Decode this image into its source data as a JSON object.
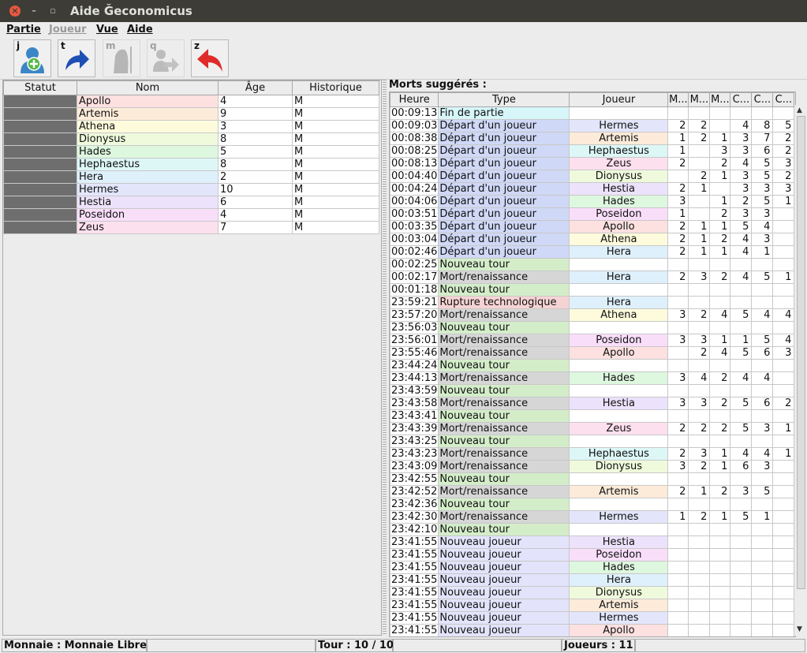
{
  "window": {
    "title": "Aide Ğeconomicus"
  },
  "menu": [
    "Partie",
    "Joueur",
    "Vue",
    "Aide"
  ],
  "toolbar": [
    {
      "key": "j",
      "icon": "add-player-icon",
      "enabled": true
    },
    {
      "key": "t",
      "icon": "next-turn-arrow-icon",
      "enabled": true
    },
    {
      "key": "m",
      "icon": "death-icon",
      "enabled": false
    },
    {
      "key": "q",
      "icon": "quit-player-icon",
      "enabled": false
    },
    {
      "key": "z",
      "icon": "undo-arrow-icon",
      "enabled": true
    }
  ],
  "players": {
    "columns": [
      "Statut",
      "Nom",
      "Âge",
      "Historique"
    ],
    "rows": [
      {
        "name": "Apollo",
        "age": "4",
        "history": "M",
        "color": "#fde0e0"
      },
      {
        "name": "Artemis",
        "age": "9",
        "history": "M",
        "color": "#fdebd9"
      },
      {
        "name": "Athena",
        "age": "3",
        "history": "M",
        "color": "#fdfbdc"
      },
      {
        "name": "Dionysus",
        "age": "8",
        "history": "M",
        "color": "#effadc"
      },
      {
        "name": "Hades",
        "age": "5",
        "history": "M",
        "color": "#def7df"
      },
      {
        "name": "Hephaestus",
        "age": "8",
        "history": "M",
        "color": "#dcf7f6"
      },
      {
        "name": "Hera",
        "age": "2",
        "history": "M",
        "color": "#def0fb"
      },
      {
        "name": "Hermes",
        "age": "10",
        "history": "M",
        "color": "#e3e6fb"
      },
      {
        "name": "Hestia",
        "age": "6",
        "history": "M",
        "color": "#ece2fb"
      },
      {
        "name": "Poseidon",
        "age": "4",
        "history": "M",
        "color": "#f9defa"
      },
      {
        "name": "Zeus",
        "age": "7",
        "history": "M",
        "color": "#fde0ee"
      }
    ]
  },
  "events": {
    "title": "Morts suggérés :",
    "columns": [
      "Heure",
      "Type",
      "Joueur",
      "M...",
      "M...",
      "M...",
      "C...",
      "C...",
      "C..."
    ],
    "type_colors": {
      "Fin de partie": "#d6f6f9",
      "Départ d'un joueur": "#cfd8f6",
      "Nouveau tour": "#d3edc9",
      "Mort/renaissance": "#d6d6d6",
      "Rupture technologique": "#f6d3d3",
      "Nouveau joueur": "#e3e3fb"
    },
    "rows": [
      {
        "time": "00:09:13",
        "type": "Fin de partie",
        "player": "",
        "v": [
          "",
          "",
          "",
          "",
          "",
          ""
        ]
      },
      {
        "time": "00:09:03",
        "type": "Départ d'un joueur",
        "player": "Hermes",
        "v": [
          "2",
          "2",
          "",
          "4",
          "8",
          "5"
        ]
      },
      {
        "time": "00:08:38",
        "type": "Départ d'un joueur",
        "player": "Artemis",
        "v": [
          "1",
          "2",
          "1",
          "3",
          "7",
          "2"
        ]
      },
      {
        "time": "00:08:25",
        "type": "Départ d'un joueur",
        "player": "Hephaestus",
        "v": [
          "1",
          "",
          "3",
          "3",
          "6",
          "2"
        ]
      },
      {
        "time": "00:08:13",
        "type": "Départ d'un joueur",
        "player": "Zeus",
        "v": [
          "2",
          "",
          "2",
          "4",
          "5",
          "3"
        ]
      },
      {
        "time": "00:04:40",
        "type": "Départ d'un joueur",
        "player": "Dionysus",
        "v": [
          "",
          "2",
          "1",
          "3",
          "5",
          "2"
        ]
      },
      {
        "time": "00:04:24",
        "type": "Départ d'un joueur",
        "player": "Hestia",
        "v": [
          "2",
          "1",
          "",
          "3",
          "3",
          "3"
        ]
      },
      {
        "time": "00:04:06",
        "type": "Départ d'un joueur",
        "player": "Hades",
        "v": [
          "3",
          "",
          "1",
          "2",
          "5",
          "1"
        ]
      },
      {
        "time": "00:03:51",
        "type": "Départ d'un joueur",
        "player": "Poseidon",
        "v": [
          "1",
          "",
          "2",
          "3",
          "3",
          ""
        ]
      },
      {
        "time": "00:03:35",
        "type": "Départ d'un joueur",
        "player": "Apollo",
        "v": [
          "2",
          "1",
          "1",
          "5",
          "4",
          ""
        ]
      },
      {
        "time": "00:03:04",
        "type": "Départ d'un joueur",
        "player": "Athena",
        "v": [
          "2",
          "1",
          "2",
          "4",
          "3",
          ""
        ]
      },
      {
        "time": "00:02:46",
        "type": "Départ d'un joueur",
        "player": "Hera",
        "v": [
          "2",
          "1",
          "1",
          "4",
          "1",
          ""
        ]
      },
      {
        "time": "00:02:25",
        "type": "Nouveau tour",
        "player": "",
        "v": [
          "",
          "",
          "",
          "",
          "",
          ""
        ]
      },
      {
        "time": "00:02:17",
        "type": "Mort/renaissance",
        "player": "Hera",
        "v": [
          "2",
          "3",
          "2",
          "4",
          "5",
          "1"
        ]
      },
      {
        "time": "00:01:18",
        "type": "Nouveau tour",
        "player": "",
        "v": [
          "",
          "",
          "",
          "",
          "",
          ""
        ]
      },
      {
        "time": "23:59:21",
        "type": "Rupture technologique",
        "player": "Hera",
        "v": [
          "",
          "",
          "",
          "",
          "",
          ""
        ]
      },
      {
        "time": "23:57:20",
        "type": "Mort/renaissance",
        "player": "Athena",
        "v": [
          "3",
          "2",
          "4",
          "5",
          "4",
          "4"
        ]
      },
      {
        "time": "23:56:03",
        "type": "Nouveau tour",
        "player": "",
        "v": [
          "",
          "",
          "",
          "",
          "",
          ""
        ]
      },
      {
        "time": "23:56:01",
        "type": "Mort/renaissance",
        "player": "Poseidon",
        "v": [
          "3",
          "3",
          "1",
          "1",
          "5",
          "4"
        ]
      },
      {
        "time": "23:55:46",
        "type": "Mort/renaissance",
        "player": "Apollo",
        "v": [
          "",
          "2",
          "4",
          "5",
          "6",
          "3"
        ]
      },
      {
        "time": "23:44:24",
        "type": "Nouveau tour",
        "player": "",
        "v": [
          "",
          "",
          "",
          "",
          "",
          ""
        ]
      },
      {
        "time": "23:44:13",
        "type": "Mort/renaissance",
        "player": "Hades",
        "v": [
          "3",
          "4",
          "2",
          "4",
          "4",
          ""
        ]
      },
      {
        "time": "23:43:59",
        "type": "Nouveau tour",
        "player": "",
        "v": [
          "",
          "",
          "",
          "",
          "",
          ""
        ]
      },
      {
        "time": "23:43:58",
        "type": "Mort/renaissance",
        "player": "Hestia",
        "v": [
          "3",
          "3",
          "2",
          "5",
          "6",
          "2"
        ]
      },
      {
        "time": "23:43:41",
        "type": "Nouveau tour",
        "player": "",
        "v": [
          "",
          "",
          "",
          "",
          "",
          ""
        ]
      },
      {
        "time": "23:43:39",
        "type": "Mort/renaissance",
        "player": "Zeus",
        "v": [
          "2",
          "2",
          "2",
          "5",
          "3",
          "1"
        ]
      },
      {
        "time": "23:43:25",
        "type": "Nouveau tour",
        "player": "",
        "v": [
          "",
          "",
          "",
          "",
          "",
          ""
        ]
      },
      {
        "time": "23:43:23",
        "type": "Mort/renaissance",
        "player": "Hephaestus",
        "v": [
          "2",
          "3",
          "1",
          "4",
          "4",
          "1"
        ]
      },
      {
        "time": "23:43:09",
        "type": "Mort/renaissance",
        "player": "Dionysus",
        "v": [
          "3",
          "2",
          "1",
          "6",
          "3",
          ""
        ]
      },
      {
        "time": "23:42:55",
        "type": "Nouveau tour",
        "player": "",
        "v": [
          "",
          "",
          "",
          "",
          "",
          ""
        ]
      },
      {
        "time": "23:42:52",
        "type": "Mort/renaissance",
        "player": "Artemis",
        "v": [
          "2",
          "1",
          "2",
          "3",
          "5",
          ""
        ]
      },
      {
        "time": "23:42:36",
        "type": "Nouveau tour",
        "player": "",
        "v": [
          "",
          "",
          "",
          "",
          "",
          ""
        ]
      },
      {
        "time": "23:42:30",
        "type": "Mort/renaissance",
        "player": "Hermes",
        "v": [
          "1",
          "2",
          "1",
          "5",
          "1",
          ""
        ]
      },
      {
        "time": "23:42:10",
        "type": "Nouveau tour",
        "player": "",
        "v": [
          "",
          "",
          "",
          "",
          "",
          ""
        ]
      },
      {
        "time": "23:41:55",
        "type": "Nouveau joueur",
        "player": "Hestia",
        "v": [
          "",
          "",
          "",
          "",
          "",
          ""
        ]
      },
      {
        "time": "23:41:55",
        "type": "Nouveau joueur",
        "player": "Poseidon",
        "v": [
          "",
          "",
          "",
          "",
          "",
          ""
        ]
      },
      {
        "time": "23:41:55",
        "type": "Nouveau joueur",
        "player": "Hades",
        "v": [
          "",
          "",
          "",
          "",
          "",
          ""
        ]
      },
      {
        "time": "23:41:55",
        "type": "Nouveau joueur",
        "player": "Hera",
        "v": [
          "",
          "",
          "",
          "",
          "",
          ""
        ]
      },
      {
        "time": "23:41:55",
        "type": "Nouveau joueur",
        "player": "Dionysus",
        "v": [
          "",
          "",
          "",
          "",
          "",
          ""
        ]
      },
      {
        "time": "23:41:55",
        "type": "Nouveau joueur",
        "player": "Artemis",
        "v": [
          "",
          "",
          "",
          "",
          "",
          ""
        ]
      },
      {
        "time": "23:41:55",
        "type": "Nouveau joueur",
        "player": "Hermes",
        "v": [
          "",
          "",
          "",
          "",
          "",
          ""
        ]
      },
      {
        "time": "23:41:55",
        "type": "Nouveau joueur",
        "player": "Apollo",
        "v": [
          "",
          "",
          "",
          "",
          "",
          ""
        ]
      }
    ]
  },
  "status": {
    "currency": "Monnaie : Monnaie Libre",
    "turn": "Tour : 10 / 10",
    "players": "Joueurs : 11"
  },
  "colors": {
    "status_cell": "#6e6e6e",
    "titlebar": "#3d3c37",
    "close_button": "#e9573f"
  }
}
